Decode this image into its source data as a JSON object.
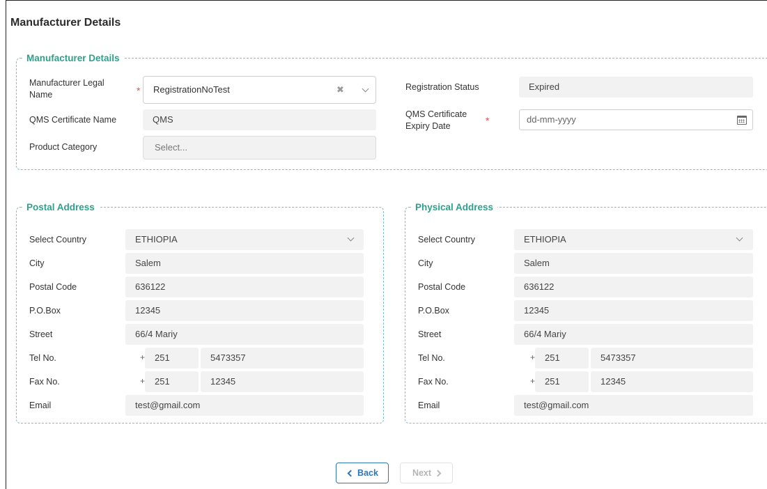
{
  "page": {
    "title": "Manufacturer Details"
  },
  "manufacturer": {
    "legend": "Manufacturer Details",
    "legal_name_label": "Manufacturer Legal Name",
    "legal_name_value": "RegistrationNoTest",
    "registration_status_label": "Registration Status",
    "registration_status_value": "Expired",
    "qms_name_label": "QMS Certificate Name",
    "qms_name_value": "QMS",
    "qms_expiry_label": "QMS Certificate Expiry Date",
    "qms_expiry_placeholder": "dd-mm-yyyy",
    "product_category_label": "Product Category",
    "product_category_placeholder": "Select..."
  },
  "postal": {
    "legend": "Postal Address",
    "country_label": "Select Country",
    "country_value": "ETHIOPIA",
    "city_label": "City",
    "city_value": "Salem",
    "postal_code_label": "Postal Code",
    "postal_code_value": "636122",
    "pobox_label": "P.O.Box",
    "pobox_value": "12345",
    "street_label": "Street",
    "street_value": "66/4 Mariy",
    "tel_label": "Tel No.",
    "tel_code": "251",
    "tel_number": "5473357",
    "fax_label": "Fax No.",
    "fax_code": "251",
    "fax_number": "12345",
    "email_label": "Email",
    "email_value": "test@gmail.com",
    "plus": "+"
  },
  "physical": {
    "legend": "Physical Address",
    "country_label": "Select Country",
    "country_value": "ETHIOPIA",
    "city_label": "City",
    "city_value": "Salem",
    "postal_code_label": "Postal Code",
    "postal_code_value": "636122",
    "pobox_label": "P.O.Box",
    "pobox_value": "12345",
    "street_label": "Street",
    "street_value": "66/4 Mariy",
    "tel_label": "Tel No.",
    "tel_code": "251",
    "tel_number": "5473357",
    "fax_label": "Fax No.",
    "fax_code": "251",
    "fax_number": "12345",
    "email_label": "Email",
    "email_value": "test@gmail.com",
    "plus": "+"
  },
  "buttons": {
    "back": "Back",
    "next": "Next"
  },
  "colors": {
    "accent_green": "#2ea08b",
    "primary_blue": "#2f76b5",
    "required_red": "#d9534f"
  }
}
